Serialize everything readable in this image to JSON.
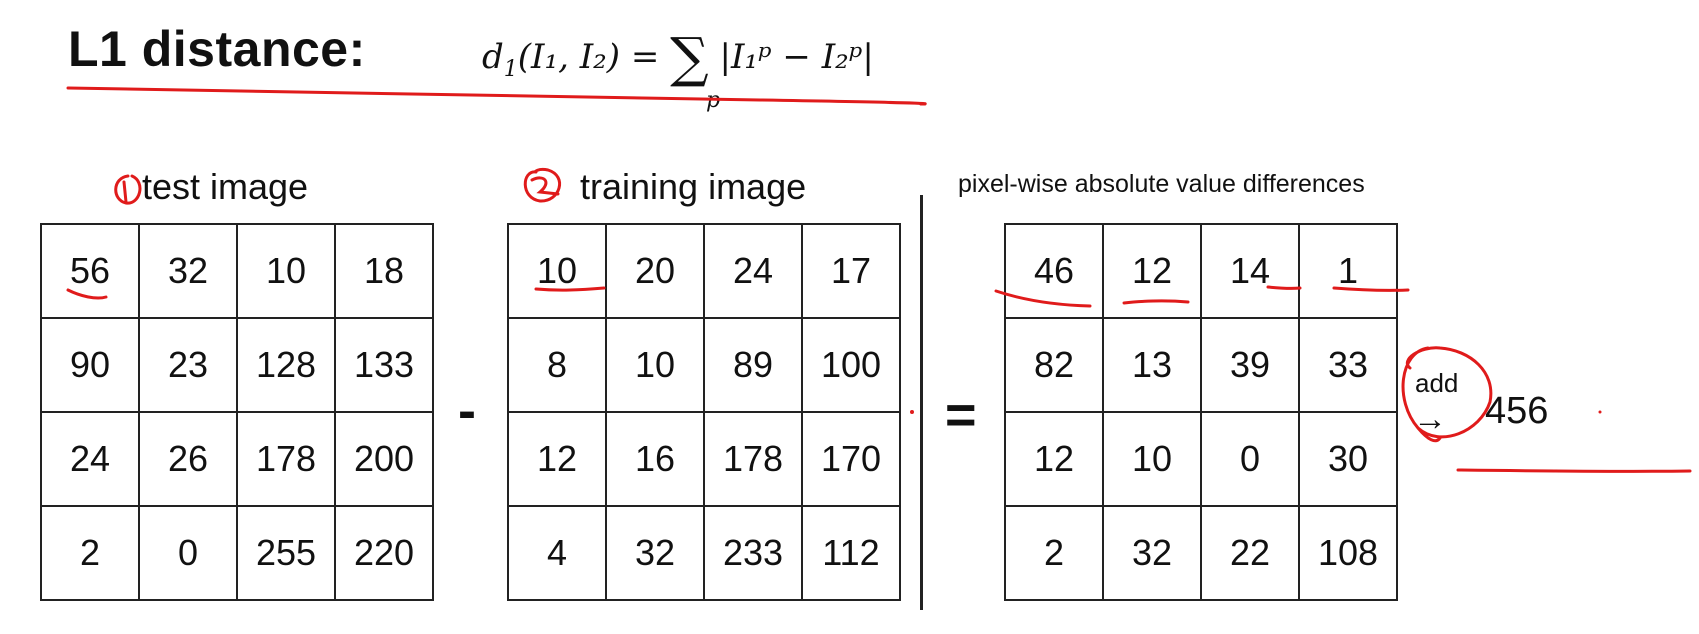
{
  "title": "L1 distance:",
  "formula": {
    "lhs": "d",
    "lhs_sub": "1",
    "args": "(I₁, I₂) =",
    "sum": "∑",
    "body": "|I₁ᵖ − I₂ᵖ|",
    "under": "p"
  },
  "test": {
    "label": "test image",
    "marker": "1",
    "rows": [
      [
        "56",
        "32",
        "10",
        "18"
      ],
      [
        "90",
        "23",
        "128",
        "133"
      ],
      [
        "24",
        "26",
        "178",
        "200"
      ],
      [
        "2",
        "0",
        "255",
        "220"
      ]
    ]
  },
  "training": {
    "label": "training image",
    "marker": "2",
    "rows": [
      [
        "10",
        "20",
        "24",
        "17"
      ],
      [
        "8",
        "10",
        "89",
        "100"
      ],
      [
        "12",
        "16",
        "178",
        "170"
      ],
      [
        "4",
        "32",
        "233",
        "112"
      ]
    ]
  },
  "diff": {
    "label": "pixel-wise absolute value differences",
    "rows": [
      [
        "46",
        "12",
        "14",
        "1"
      ],
      [
        "82",
        "13",
        "39",
        "33"
      ],
      [
        "12",
        "10",
        "0",
        "30"
      ],
      [
        "2",
        "32",
        "22",
        "108"
      ]
    ]
  },
  "operators": {
    "minus": "-",
    "equals": "="
  },
  "add_label": "add",
  "arrow": "→",
  "total": "456",
  "ink_color": "#e01b1b"
}
